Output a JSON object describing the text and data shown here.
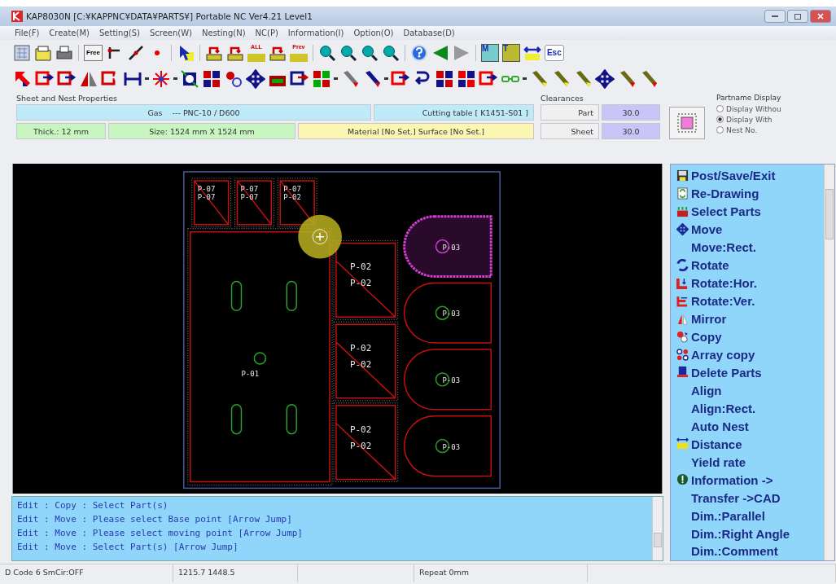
{
  "window": {
    "title": "KAP8030N [C:¥KAPPNC¥DATA¥PARTS¥] Portable NC Ver4.21 Level1"
  },
  "menu": [
    "File(F)",
    "Create(M)",
    "Setting(S)",
    "Screen(W)",
    "Nesting(N)",
    "NC(P)",
    "Information(I)",
    "Option(O)",
    "Database(D)"
  ],
  "toolbar": {
    "free_label": "Free",
    "all_label": "ALL",
    "prev_label": "Prev",
    "m_label": "M",
    "t_label": "T",
    "esc_label": "Esc"
  },
  "properties": {
    "title": "Sheet and Nest Properties",
    "gas": "Gas",
    "machine": "--- PNC-10 / D600",
    "cutting_table": "Cutting table  [ K1451-S01 ]",
    "thickness": "Thick.: 12 mm",
    "size": "Size: 1524 mm X 1524 mm",
    "material": "Material [No Set.] Surface [No Set.]"
  },
  "clearances": {
    "title": "Clearances",
    "rows": [
      {
        "label": "Part",
        "value": "30.0"
      },
      {
        "label": "Sheet",
        "value": "30.0"
      }
    ]
  },
  "partname_display": {
    "title": "Partname Display",
    "options": [
      {
        "label": "Display Withou",
        "selected": false
      },
      {
        "label": "Display With",
        "selected": true
      },
      {
        "label": "Nest No.",
        "selected": false
      }
    ]
  },
  "canvas": {
    "small_parts": [
      {
        "labels": [
          "P-07",
          "P-07"
        ]
      },
      {
        "labels": [
          "P-07",
          "P-07"
        ]
      },
      {
        "labels": [
          "P-07",
          "P-02"
        ]
      }
    ],
    "large_part": {
      "label": "P-01"
    },
    "middle_parts": [
      {
        "labels": [
          "P-02",
          "P-02"
        ]
      },
      {
        "labels": [
          "P-02",
          "P-02"
        ]
      },
      {
        "labels": [
          "P-02",
          "P-02"
        ]
      }
    ],
    "right_parts": [
      {
        "label": "P-03",
        "selected": true
      },
      {
        "label": "P-03",
        "selected": false
      },
      {
        "label": "P-03",
        "selected": false
      },
      {
        "label": "P-03",
        "selected": false
      }
    ]
  },
  "commands": [
    {
      "label": "Post/Save/Exit",
      "kind": "save"
    },
    {
      "label": "Re-Drawing",
      "kind": "redraw"
    },
    {
      "label": "Select Parts",
      "kind": "select"
    },
    {
      "label": "Move",
      "kind": "move"
    },
    {
      "label": "Move:Rect."
    },
    {
      "label": "Rotate",
      "kind": "rotate"
    },
    {
      "label": "Rotate:Hor.",
      "kind": "rotate-hor"
    },
    {
      "label": "Rotate:Ver.",
      "kind": "rotate-ver"
    },
    {
      "label": "Mirror",
      "kind": "mirror"
    },
    {
      "label": "Copy",
      "kind": "copy"
    },
    {
      "label": "Array copy",
      "kind": "array"
    },
    {
      "label": "Delete Parts",
      "kind": "delete"
    },
    {
      "label": "Align"
    },
    {
      "label": "Align:Rect."
    },
    {
      "label": "Auto Nest"
    },
    {
      "label": "Distance",
      "kind": "distance"
    },
    {
      "label": "Yield rate"
    },
    {
      "label": "Information ->",
      "kind": "info"
    },
    {
      "label": "Transfer ->CAD"
    },
    {
      "label": "Dim.:Parallel"
    },
    {
      "label": "Dim.:Right Angle"
    },
    {
      "label": "Dim.:Comment"
    }
  ],
  "log": [
    "Edit : Copy : Select Part(s)",
    "Edit : Move : Please select Base point [Arrow Jump]",
    "Edit : Move : Please select moving point [Arrow Jump]",
    "Edit : Move : Select Part(s) [Arrow Jump]"
  ],
  "status_bar": {
    "mode": "D Code 6 SmCir:OFF",
    "coordinates": "1215.7 1448.5",
    "repeat": "Repeat 0mm"
  }
}
